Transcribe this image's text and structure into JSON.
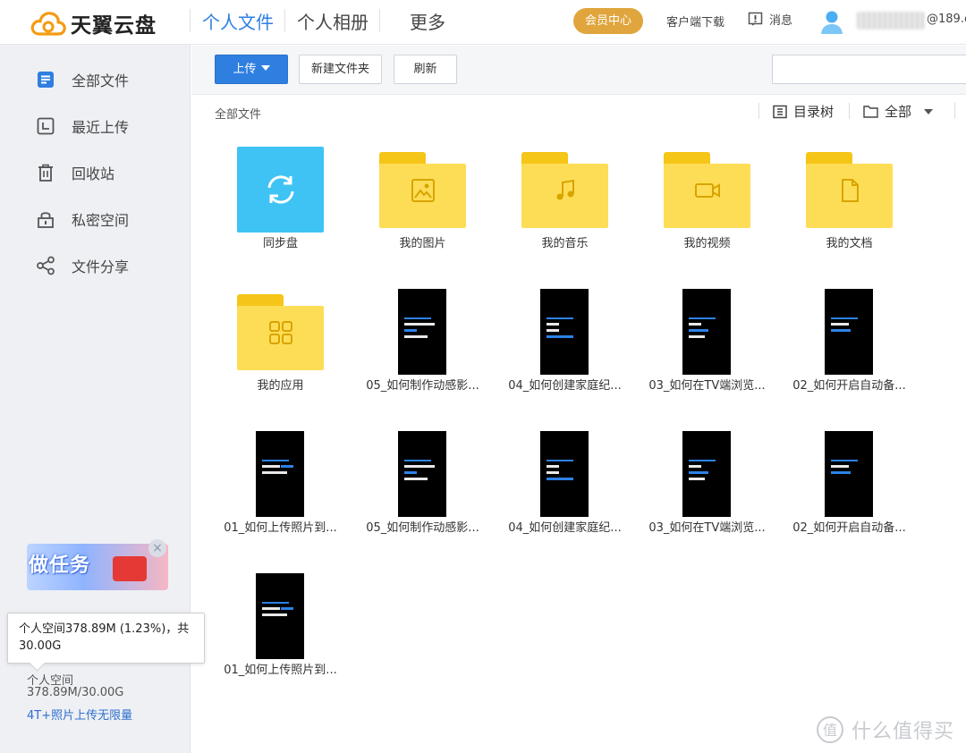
{
  "app": {
    "name": "天翼云盘"
  },
  "nav": [
    {
      "label": "个人文件",
      "active": true
    },
    {
      "label": "个人相册",
      "active": false
    },
    {
      "label": "更多",
      "active": false
    }
  ],
  "header": {
    "vip_label": "会员中心",
    "client_download": "客户端下载",
    "messages": "消息",
    "account_suffix": "@189.c"
  },
  "sidebar": {
    "items": [
      {
        "label": "全部文件",
        "icon": "all-files-icon"
      },
      {
        "label": "最近上传",
        "icon": "recent-upload-icon"
      },
      {
        "label": "回收站",
        "icon": "recycle-bin-icon"
      },
      {
        "label": "私密空间",
        "icon": "private-space-icon"
      },
      {
        "label": "文件分享",
        "icon": "share-icon"
      }
    ],
    "promo_text": "做任务",
    "tooltip": "个人空间378.89M (1.23%)，共30.00G",
    "space_label": "个人空间",
    "space_value": "378.89M/30.00G",
    "space_usage": 0.0123,
    "space_link": "4T+照片上传无限量"
  },
  "toolbar": {
    "upload": "上传",
    "new_folder": "新建文件夹",
    "refresh": "刷新"
  },
  "breadcrumb": "全部文件",
  "view": {
    "tree": "目录树",
    "filter": "全部"
  },
  "files": [
    {
      "name": "同步盘",
      "kind": "sync"
    },
    {
      "name": "我的图片",
      "kind": "folder",
      "icon": "image-icon"
    },
    {
      "name": "我的音乐",
      "kind": "folder",
      "icon": "music-icon"
    },
    {
      "name": "我的视频",
      "kind": "folder",
      "icon": "video-icon"
    },
    {
      "name": "我的文档",
      "kind": "folder",
      "icon": "document-icon"
    },
    {
      "name": "我的应用",
      "kind": "folder",
      "icon": "apps-icon"
    },
    {
      "name": "05_如何制作动感影...",
      "kind": "video"
    },
    {
      "name": "04_如何创建家庭纪...",
      "kind": "video"
    },
    {
      "name": "03_如何在TV端浏览...",
      "kind": "video"
    },
    {
      "name": "02_如何开启自动备...",
      "kind": "video"
    },
    {
      "name": "01_如何上传照片到...",
      "kind": "video"
    },
    {
      "name": "05_如何制作动感影...",
      "kind": "video"
    },
    {
      "name": "04_如何创建家庭纪...",
      "kind": "video"
    },
    {
      "name": "03_如何在TV端浏览...",
      "kind": "video"
    },
    {
      "name": "02_如何开启自动备...",
      "kind": "video"
    },
    {
      "name": "01_如何上传照片到...",
      "kind": "video"
    }
  ],
  "watermark": "什么值得买",
  "colors": {
    "accent": "#2f7fe0",
    "vip": "#e0a53c",
    "folder": "#fddd56",
    "sync": "#3fc3f5"
  }
}
